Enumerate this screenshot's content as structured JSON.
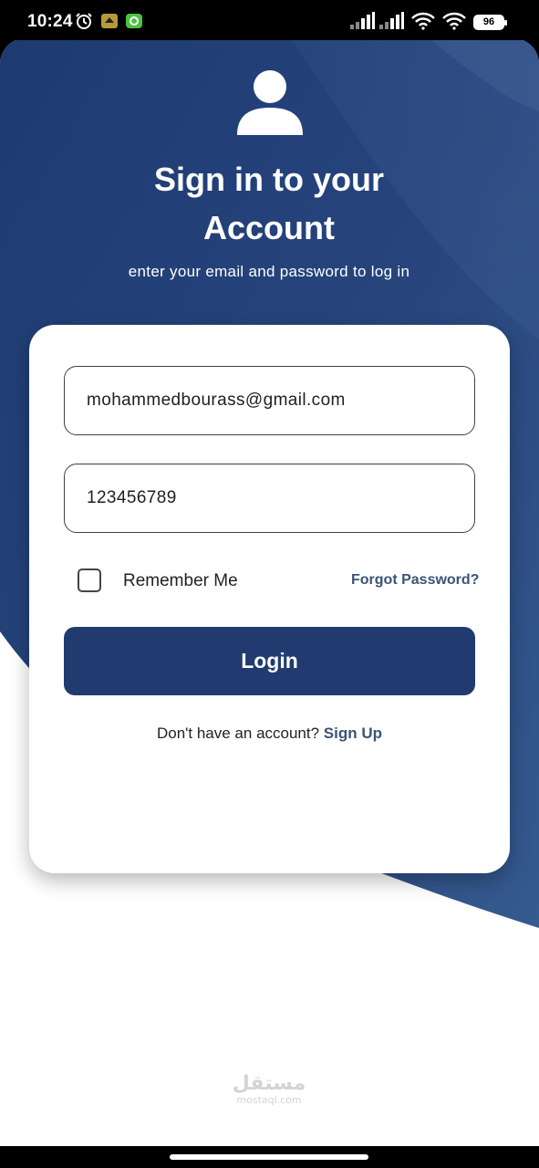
{
  "status_bar": {
    "time": "10:24",
    "battery": "96",
    "icons": [
      "alarm-icon",
      "app-notification-icon",
      "green-app-icon",
      "signal-icon",
      "signal-icon",
      "wifi-icon",
      "wifi-icon",
      "battery-icon"
    ]
  },
  "header": {
    "title_line1": "Sign in to your",
    "title_line2": "Account",
    "subtitle": "enter your email and password to log in",
    "icon": "person-icon"
  },
  "form": {
    "email_value": "mohammedbourass@gmail.com",
    "password_value": "123456789",
    "remember_label": "Remember Me",
    "remember_checked": false,
    "forgot_label": "Forgot Password?",
    "login_label": "Login",
    "signup_prompt": "Don't have an account?",
    "signup_label": "Sign Up"
  },
  "watermark": {
    "arabic": "مستقل",
    "latin": "mostaql.com"
  },
  "colors": {
    "primary": "#213b70",
    "link": "#3b5477",
    "background_blue": "#1f3c73"
  }
}
